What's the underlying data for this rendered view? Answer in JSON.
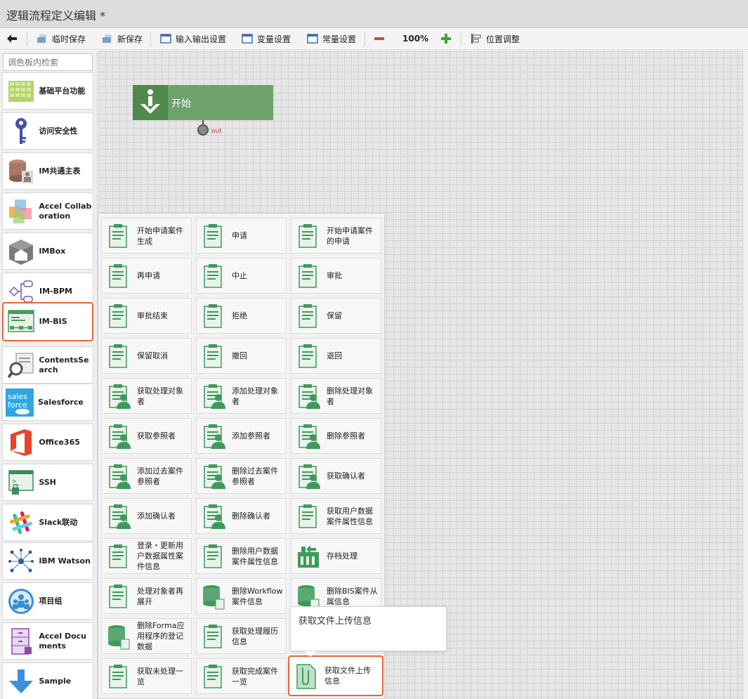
{
  "window": {
    "title": "逻辑流程定义编辑  *"
  },
  "toolbar": {
    "back_icon": "back-arrow-icon",
    "temp_save": "临时保存",
    "new_save": "新保存",
    "io_settings": "输入输出设置",
    "var_settings": "变量设置",
    "const_settings": "常量设置",
    "zoom": "100%",
    "position_adjust": "位置调整"
  },
  "sidebar": {
    "search_placeholder": "调色板内检索",
    "items": [
      {
        "label": "基础平台功能"
      },
      {
        "label": "访问安全性"
      },
      {
        "label": "IM共通主表"
      },
      {
        "label": "Accel Collaboration"
      },
      {
        "label": "IMBox"
      },
      {
        "label": "IM-BPM"
      },
      {
        "label": "IM-BIS"
      },
      {
        "label": "ContentsSearch"
      },
      {
        "label": "Salesforce"
      },
      {
        "label": "Office365"
      },
      {
        "label": "SSH"
      },
      {
        "label": "Slack联动"
      },
      {
        "label": "IBM Watson"
      },
      {
        "label": "项目组"
      },
      {
        "label": "Accel Documents"
      },
      {
        "label": "Sample"
      }
    ],
    "salesforce_logo_text": "sales force"
  },
  "canvas": {
    "start_node_label": "开始",
    "out_port_label": "out"
  },
  "palette": {
    "items": [
      {
        "label": "开始申请案件生成"
      },
      {
        "label": "申请"
      },
      {
        "label": "开始申请案件的申请"
      },
      {
        "label": "再申请"
      },
      {
        "label": "中止"
      },
      {
        "label": "审批"
      },
      {
        "label": "审批结束"
      },
      {
        "label": "拒绝"
      },
      {
        "label": "保留"
      },
      {
        "label": "保留取消"
      },
      {
        "label": "撤回"
      },
      {
        "label": "退回"
      },
      {
        "label": "获取处理对象者"
      },
      {
        "label": "添加处理对象者"
      },
      {
        "label": "删除处理对象者"
      },
      {
        "label": "获取参照者"
      },
      {
        "label": "添加参照者"
      },
      {
        "label": "删除参照者"
      },
      {
        "label": "添加过去案件参照者"
      },
      {
        "label": "删除过去案件参照者"
      },
      {
        "label": "获取确认者"
      },
      {
        "label": "添加确认者"
      },
      {
        "label": "删除确认者"
      },
      {
        "label": "获取用户数据案件属性信息"
      },
      {
        "label": "登录・更新用户数据属性案件信息"
      },
      {
        "label": "删除用户数据案件属性信息"
      },
      {
        "label": "存档处理"
      },
      {
        "label": "处理对象者再展开"
      },
      {
        "label": "删除Workflow案件信息"
      },
      {
        "label": "删除BIS案件从属信息"
      },
      {
        "label": "删除Forma应用程序的登记数据"
      },
      {
        "label": "获取处理履历信息"
      },
      {
        "label": ""
      },
      {
        "label": "获取未处理一览"
      },
      {
        "label": "获取完成案件一览"
      },
      {
        "label": "获取文件上传信息"
      }
    ],
    "tooltip": "获取文件上传信息"
  },
  "colors": {
    "accent": "#e8663b",
    "node_green": "#6da26a",
    "icon_green": "#3f9a5a"
  }
}
